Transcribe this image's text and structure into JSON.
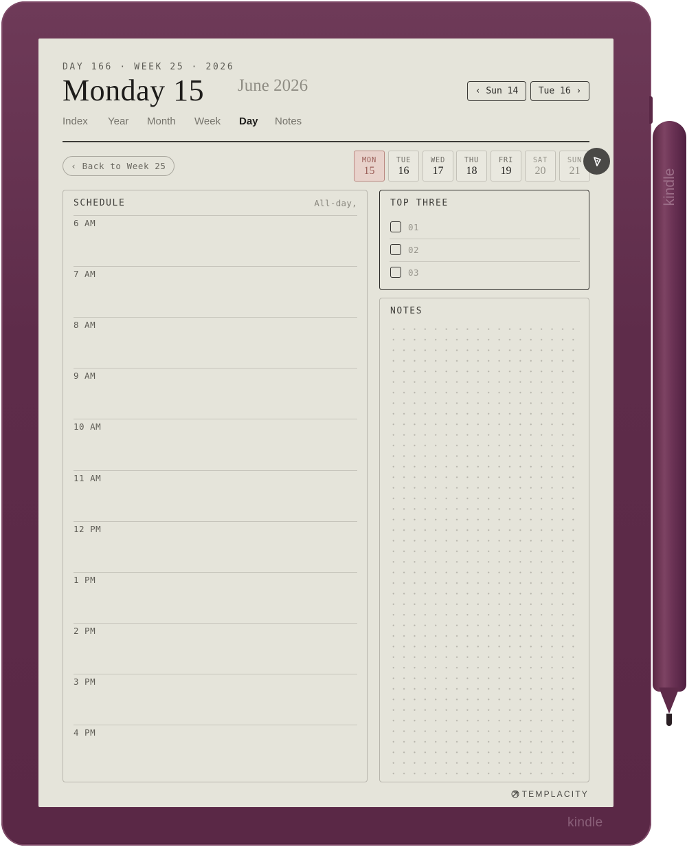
{
  "header": {
    "meta": "DAY 166 · WEEK 25 · 2026",
    "title": "Monday 15",
    "month": "June 2026",
    "prev_label": "‹ Sun 14",
    "next_label": "Tue 16 ›"
  },
  "tabs": [
    {
      "label": "Index",
      "active": false
    },
    {
      "label": "Year",
      "active": false
    },
    {
      "label": "Month",
      "active": false
    },
    {
      "label": "Week",
      "active": false
    },
    {
      "label": "Day",
      "active": true
    },
    {
      "label": "Notes",
      "active": false
    }
  ],
  "back_button": "‹ Back to Week 25",
  "week_days": [
    {
      "name": "MON",
      "date": "15",
      "active": true
    },
    {
      "name": "TUE",
      "date": "16"
    },
    {
      "name": "WED",
      "date": "17"
    },
    {
      "name": "THU",
      "date": "18"
    },
    {
      "name": "FRI",
      "date": "19"
    },
    {
      "name": "SAT",
      "date": "20",
      "weekend": true
    },
    {
      "name": "SUN",
      "date": "21",
      "weekend": true
    }
  ],
  "schedule": {
    "title": "SCHEDULE",
    "all_day": "All-day,",
    "hours": [
      "6 AM",
      "7 AM",
      "8 AM",
      "9 AM",
      "10 AM",
      "11 AM",
      "12 PM",
      "1 PM",
      "2 PM",
      "3 PM",
      "4 PM"
    ]
  },
  "top_three": {
    "title": "TOP THREE",
    "items": [
      "01",
      "02",
      "03"
    ]
  },
  "notes": {
    "title": "NOTES"
  },
  "footer": {
    "brand": "TEMPLACITY"
  },
  "device": {
    "brand": "kindle",
    "pen_brand": "kindle"
  },
  "colors": {
    "device": "#5e2c4a",
    "screen": "#e5e4da",
    "active_day": "#e8d2cb"
  },
  "icons": {
    "fab": "pen-tip-icon",
    "footer": "templacity-logo-icon"
  }
}
